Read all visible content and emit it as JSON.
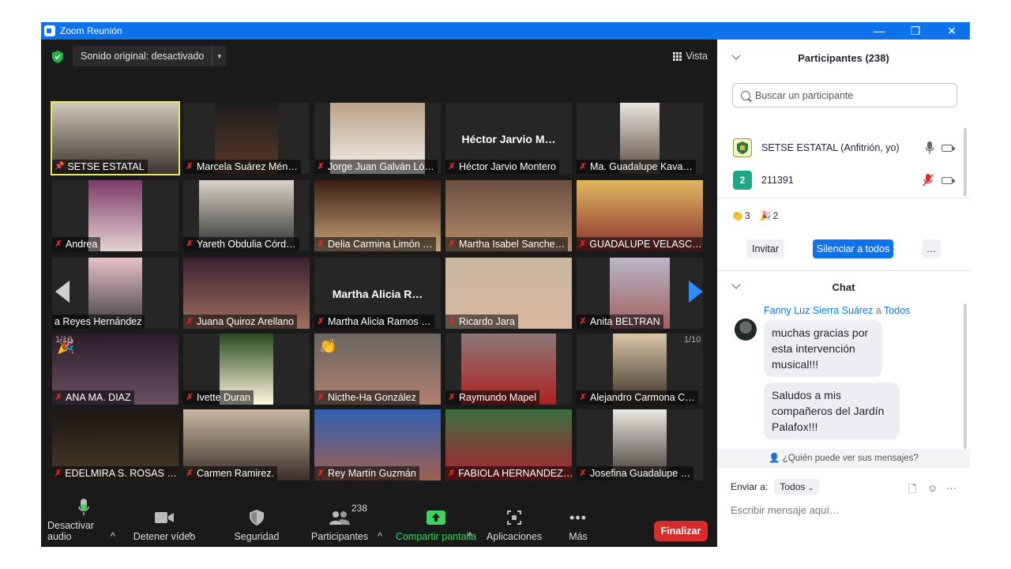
{
  "window": {
    "title": "Zoom Reunión",
    "controls": [
      "—",
      "❐",
      "✕"
    ]
  },
  "meeting": {
    "sound_button": "Sonido original: desactivado",
    "view_label": "Vista",
    "page_left": "1/10",
    "page_right": "1/10",
    "tiles": [
      {
        "name": "SETSE ESTATAL",
        "muted": false,
        "pinned": true
      },
      {
        "name": "Marcela Suárez Mén…",
        "muted": true
      },
      {
        "name": "Jorge Juan Galván Ló…",
        "muted": true
      },
      {
        "name": "Héctor Jarvio Montero",
        "muted": true,
        "big": "Héctor Jarvio M…"
      },
      {
        "name": "Ma. Guadalupe Kava…",
        "muted": true
      },
      {
        "name": "Andrea",
        "muted": true
      },
      {
        "name": "Yareth Obdulia Córd…",
        "muted": true
      },
      {
        "name": "Delia Carmina Limón …",
        "muted": true
      },
      {
        "name": "Martha Isabel Sanche…",
        "muted": true
      },
      {
        "name": "GUADALUPE VELASC…",
        "muted": true
      },
      {
        "name": "a Reyes Hernández",
        "muted": false
      },
      {
        "name": "Juana Quiroz Arellano",
        "muted": true
      },
      {
        "name": "Martha Alicia Ramos …",
        "muted": true,
        "big": "Martha Alicia R…"
      },
      {
        "name": "Ricardo Jara",
        "muted": true
      },
      {
        "name": "Anita BELTRAN",
        "muted": true
      },
      {
        "name": "ANA MA. DIAZ",
        "muted": true,
        "reaction": "🎉"
      },
      {
        "name": "Ivette Duran",
        "muted": true
      },
      {
        "name": "Nicthe-Ha González",
        "muted": true,
        "reaction": "👏"
      },
      {
        "name": "Raymundo Mapel",
        "muted": true
      },
      {
        "name": "Alejandro Carmona C…",
        "muted": true
      },
      {
        "name": "EDELMIRA S. ROSAS …",
        "muted": true
      },
      {
        "name": "Carmen Ramirez.",
        "muted": true
      },
      {
        "name": "Rey Martín Guzmán",
        "muted": true
      },
      {
        "name": "FABIOLA HERNANDEZ…",
        "muted": true
      },
      {
        "name": "Josefina Guadalupe …",
        "muted": true
      }
    ]
  },
  "toolbar": {
    "audio": "Desactivar audio",
    "video": "Detener vídeo",
    "security": "Seguridad",
    "participants": "Participantes",
    "participants_count": "238",
    "share": "Compartir pantalla",
    "apps": "Aplicaciones",
    "more": "Más",
    "end": "Finalizar"
  },
  "participants_panel": {
    "title": "Participantes (238)",
    "search_placeholder": "Buscar un participante",
    "rows": [
      {
        "name": "SETSE ESTATAL (Anfitrión, yo)",
        "avatar": ""
      },
      {
        "name": "211391",
        "avatar": "2"
      }
    ],
    "reactions": [
      {
        "icon": "👏",
        "count": "3"
      },
      {
        "icon": "🎉",
        "count": "2"
      }
    ],
    "invite": "Invitar",
    "mute_all": "Silenciar a todos",
    "more": "…"
  },
  "chat": {
    "title": "Chat",
    "sender": "Fanny Luz Sierra Suárez",
    "to_word": "a",
    "recipient": "Todos",
    "messages": [
      "muchas gracias por esta intervención musical!!!",
      "Saludos a mis compañeros del Jardín Palafox!!!"
    ],
    "who_can_see": "¿Quién puede ver sus mensajes?",
    "send_to_label": "Enviar a:",
    "send_to_value": "Todos",
    "input_placeholder": "Escribir mensaje aquí…"
  },
  "colors": {
    "accent": "#0e72ed",
    "end": "#d62c2c",
    "share": "#3fd361",
    "speaker": "#e8e86a",
    "mute": "#e02828"
  }
}
